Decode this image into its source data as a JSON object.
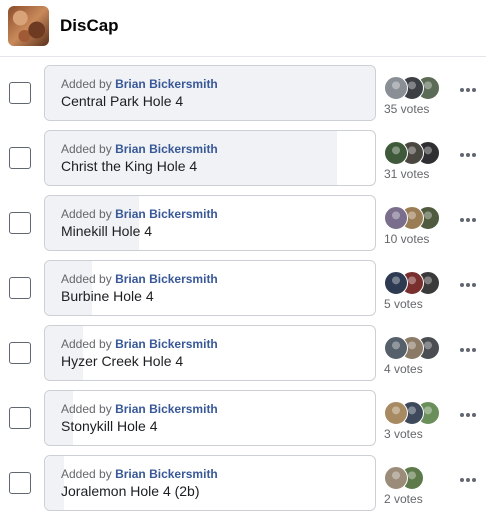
{
  "group": {
    "name": "DisCap",
    "avatar_icon": "group-photo-icon"
  },
  "colors": {
    "author_link": "#385898",
    "bar_fill": "#f0f2f5",
    "border": "#ccd0d5",
    "muted_text": "#65676b"
  },
  "poll": {
    "added_by_prefix": "Added by",
    "options": [
      {
        "name": "Central Park Hole 4",
        "author": "Brian Bickersmith",
        "votes_label": "35 votes",
        "votes": 35,
        "fill_fraction": 1.0,
        "voter_colors": [
          "#8a8f96",
          "#3c3f44",
          "#5b6b55"
        ]
      },
      {
        "name": "Christ the King Hole 4",
        "author": "Brian Bickersmith",
        "votes_label": "31 votes",
        "votes": 31,
        "fill_fraction": 0.886,
        "voter_colors": [
          "#3f5a3a",
          "#4a4640",
          "#2f2f33"
        ]
      },
      {
        "name": "Minekill Hole 4",
        "author": "Brian Bickersmith",
        "votes_label": "10 votes",
        "votes": 10,
        "fill_fraction": 0.286,
        "voter_colors": [
          "#7a6e8c",
          "#9b7d55",
          "#4f5a3e"
        ]
      },
      {
        "name": "Burbine Hole 4",
        "author": "Brian Bickersmith",
        "votes_label": "5 votes",
        "votes": 5,
        "fill_fraction": 0.143,
        "voter_colors": [
          "#2d3a52",
          "#7a2f2f",
          "#3a3a3a"
        ]
      },
      {
        "name": "Hyzer Creek Hole 4",
        "author": "Brian Bickersmith",
        "votes_label": "4 votes",
        "votes": 4,
        "fill_fraction": 0.114,
        "voter_colors": [
          "#55606a",
          "#8a7a66",
          "#4a4d52"
        ]
      },
      {
        "name": "Stonykill Hole 4",
        "author": "Brian Bickersmith",
        "votes_label": "3 votes",
        "votes": 3,
        "fill_fraction": 0.086,
        "voter_colors": [
          "#a88a62",
          "#3e4a5c",
          "#6b8f5a"
        ]
      },
      {
        "name": "Joralemon Hole 4 (2b)",
        "author": "Brian Bickersmith",
        "votes_label": "2 votes",
        "votes": 2,
        "fill_fraction": 0.057,
        "voter_colors": [
          "#9a8c78",
          "#5e7a4a"
        ]
      }
    ]
  }
}
